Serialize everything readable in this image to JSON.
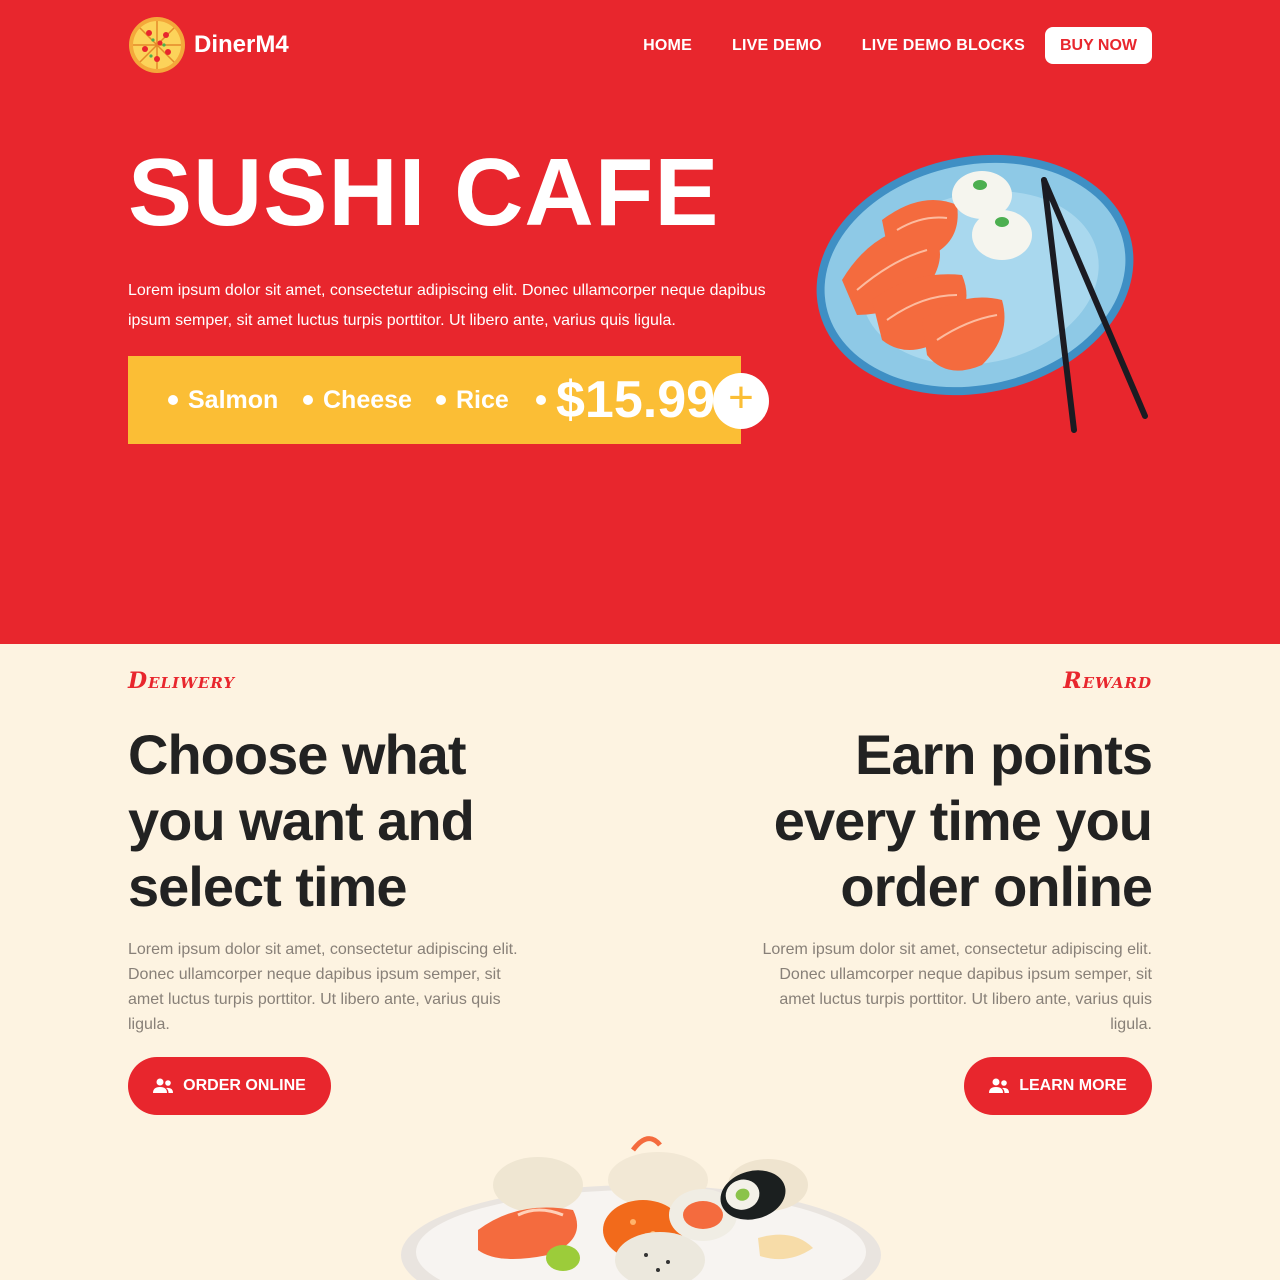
{
  "nav": {
    "brand": "DinerM4",
    "items": [
      "HOME",
      "LIVE DEMO",
      "LIVE DEMO BLOCKS"
    ],
    "buy_label": "BUY NOW"
  },
  "hero": {
    "title": "SUSHI CAFE",
    "text": "Lorem ipsum dolor sit amet, consectetur adipiscing elit. Donec ullamcorper neque dapibus ipsum semper, sit amet luctus turpis porttitor. Ut libero ante, varius quis ligula.",
    "ingredients": [
      "Salmon",
      "Cheese",
      "Rice"
    ],
    "price": "$15.99",
    "add_label": "+"
  },
  "features": {
    "left": {
      "kicker": "Deliwery",
      "title_lines": [
        "Choose what",
        "you want and",
        "select time"
      ],
      "text": "Lorem ipsum dolor sit amet, consectetur adipiscing elit. Donec ullamcorper neque dapibus ipsum semper, sit amet luctus turpis porttitor. Ut libero ante, varius quis ligula.",
      "button": "ORDER ONLINE"
    },
    "right": {
      "kicker": "Reward",
      "title_lines": [
        "Earn points",
        "every time you",
        "order online"
      ],
      "text": "Lorem ipsum dolor sit amet, consectetur adipiscing elit. Donec ullamcorper neque dapibus ipsum semper, sit amet luctus turpis porttitor. Ut libero ante, varius quis ligula.",
      "button": "LEARN MORE"
    }
  },
  "colors": {
    "primary": "#e8262d",
    "accent": "#fbbe35",
    "cream": "#fdf3e1",
    "dark": "#222222"
  },
  "icons": {
    "logo": "pizza-icon",
    "button": "users-icon"
  }
}
